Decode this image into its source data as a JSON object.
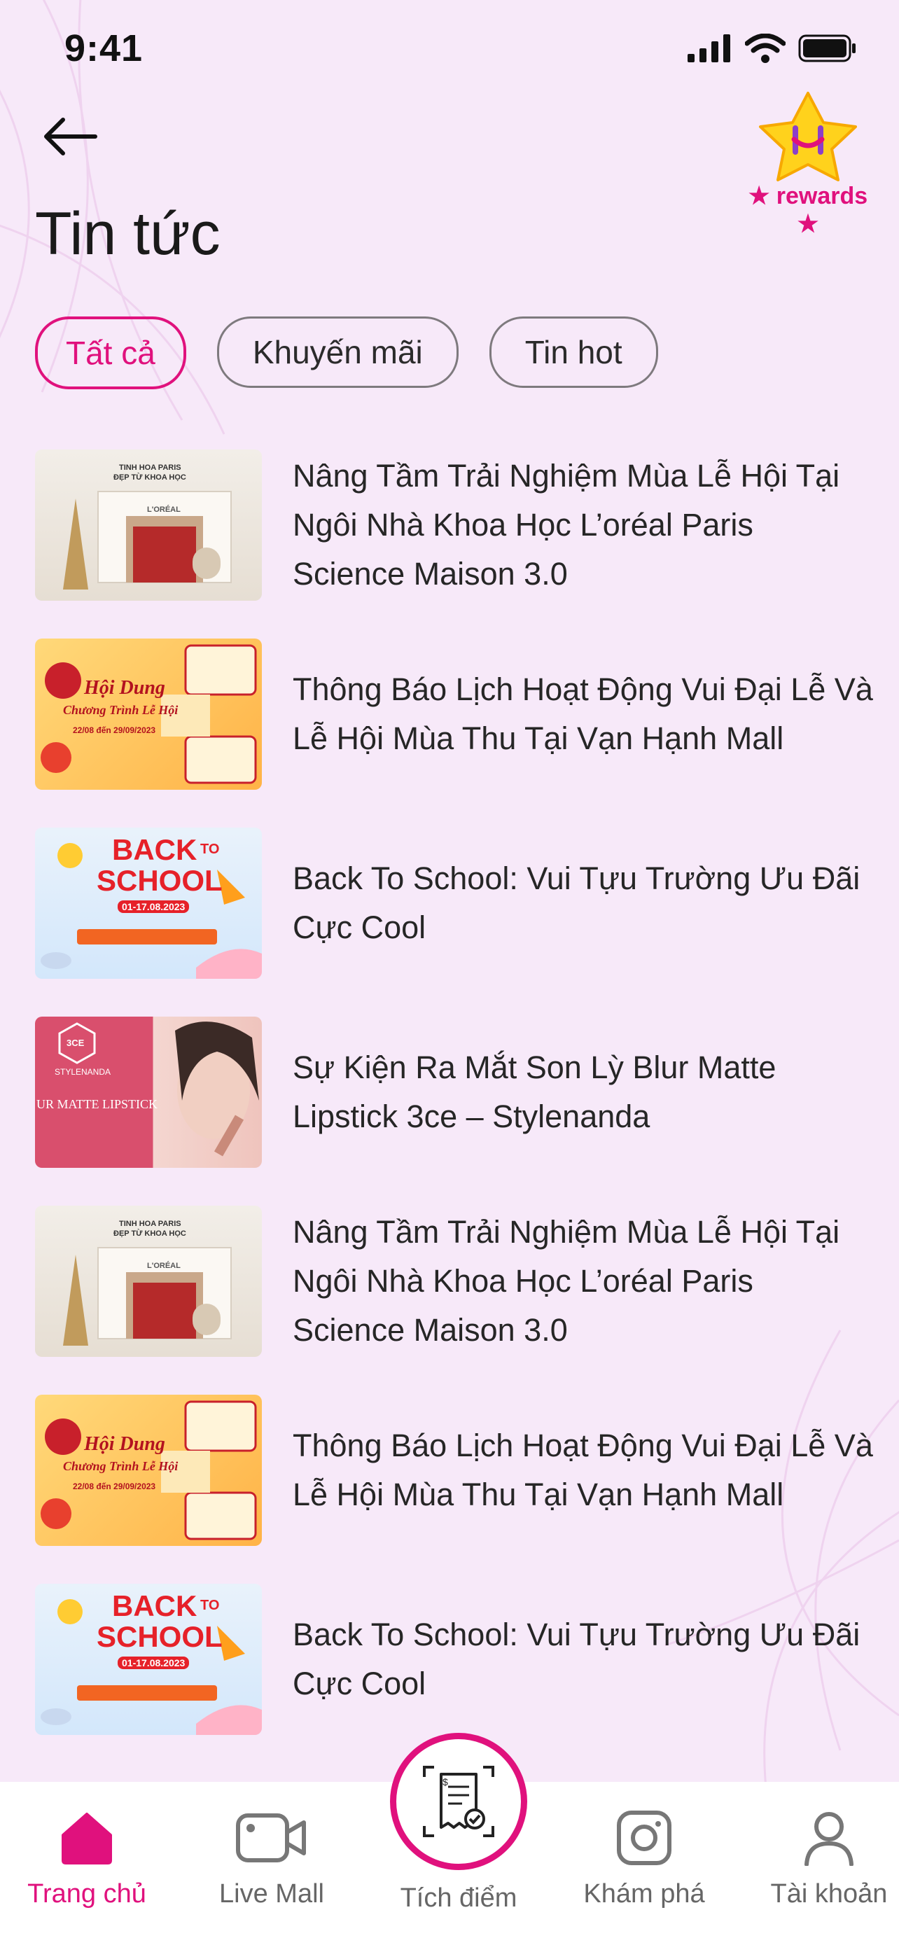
{
  "status_bar": {
    "time": "9:41"
  },
  "header": {
    "title": "Tin tức",
    "rewards_label": "rewards"
  },
  "filters": [
    {
      "label": "Tất cả",
      "active": true
    },
    {
      "label": "Khuyến mãi",
      "active": false
    },
    {
      "label": "Tin hot",
      "active": false
    }
  ],
  "news": [
    {
      "title": "Nâng Tầm Trải Nghiệm Mùa Lễ Hội Tại Ngôi Nhà Khoa Học L’oréal Paris Science Maison 3.0",
      "thumb": "loreal"
    },
    {
      "title": "Thông Báo Lịch Hoạt Động Vui Đại Lễ Và Lễ Hội Mùa Thu Tại Vạn Hạnh Mall",
      "thumb": "festival"
    },
    {
      "title": "Back To School: Vui Tựu Trường Ưu Đãi Cực Cool",
      "thumb": "school"
    },
    {
      "title": "Sự Kiện Ra Mắt Son Lỳ Blur Matte Lipstick 3ce – Stylenanda",
      "thumb": "lipstick"
    },
    {
      "title": "Nâng Tầm Trải Nghiệm Mùa Lễ Hội Tại Ngôi Nhà Khoa Học L’oréal Paris Science Maison 3.0",
      "thumb": "loreal"
    },
    {
      "title": "Thông Báo Lịch Hoạt Động Vui Đại Lễ Và Lễ Hội Mùa Thu Tại Vạn Hạnh Mall",
      "thumb": "festival"
    },
    {
      "title": "Back To School: Vui Tựu Trường Ưu Đãi Cực Cool",
      "thumb": "school"
    }
  ],
  "thumb_text": {
    "loreal_top": "TINH HOA PARIS",
    "loreal_sub": "ĐẸP TỪ KHOA HỌC",
    "loreal_brand": "L'ORÉAL",
    "festival_line1": "Hội Dung",
    "festival_line2": "Chương Trình Lễ Hội",
    "festival_dates": "22/08 đến 29/09/2023",
    "school_back": "BACK",
    "school_to": "TO",
    "school_school": "SCHOOL",
    "school_dates": "01-17.08.2023",
    "lipstick_brand": "STYLENANDA",
    "lipstick_logo": "3CE",
    "lipstick_product": "UR MATTE LIPSTICK"
  },
  "bottom_nav": {
    "items": [
      {
        "label": "Trang chủ",
        "icon": "home-icon",
        "active": true
      },
      {
        "label": "Live Mall",
        "icon": "video-icon",
        "active": false
      },
      {
        "label": "Tích điểm",
        "icon": "receipt-scan-icon",
        "active": false
      },
      {
        "label": "Khám phá",
        "icon": "instagram-icon",
        "active": false
      },
      {
        "label": "Tài khoản",
        "icon": "user-icon",
        "active": false
      }
    ]
  },
  "colors": {
    "accent": "#e0117d",
    "background": "#f7e9f9"
  }
}
